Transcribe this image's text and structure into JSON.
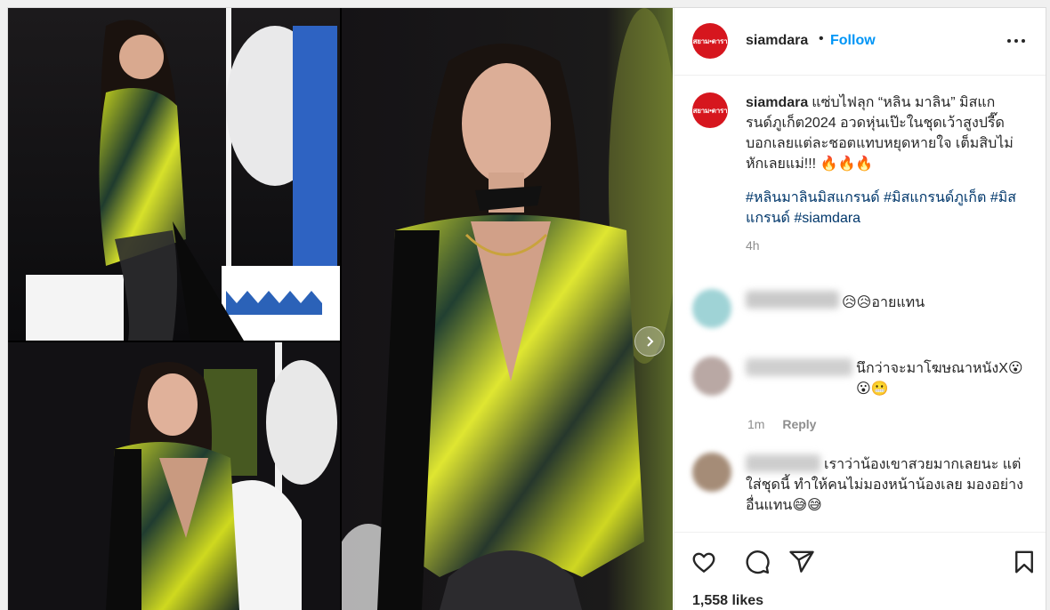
{
  "post": {
    "username": "siamdara",
    "follow_label": "Follow",
    "avatar_text": "สยาม•ดารา",
    "caption_text": "แซ่บไฟลุก “หลิน มาลิน” มิสแกรนด์ภูเก็ต2024 อวดหุ่นเป๊ะในชุดเว้าสูงปรี๊ดบอกเลยแต่ละชอตแทบหยุดหายใจ เต็มสิบไม่หักเลยแม่!!! 🔥🔥🔥",
    "hashtags": [
      "#หลินมาลินมิสแกรนด์",
      "#มิสแกรนด์ภูเก็ต",
      "#มิสแกรนด์",
      "#siamdara"
    ],
    "time_ago": "4h",
    "likes": "1,558 likes"
  },
  "comments": [
    {
      "text": "😥😥อายแทน",
      "avatar_color": "#9fd3d6",
      "meta_time": "",
      "meta_reply": ""
    },
    {
      "text": "นึกว่าจะมาโฆษณาหนังX😮😮😬",
      "avatar_color": "#b9a8a4",
      "meta_time": "1m",
      "meta_reply": "Reply"
    },
    {
      "text": "เราว่าน้องเขาสวยมากเลยนะ แต่ใส่ชุดนี้ ทำให้คนไม่มองหน้าน้องเลย มองอย่างอื่นแทน😅😅",
      "avatar_color": "#a58c77",
      "meta_time": "",
      "meta_reply": ""
    }
  ],
  "icons": {
    "more": "more-options-icon",
    "like": "heart-icon",
    "comment": "comment-bubble-icon",
    "share": "paper-plane-icon",
    "save": "bookmark-icon",
    "next": "chevron-right-icon"
  },
  "colors": {
    "brand_red": "#d6161e",
    "follow_blue": "#0095f6",
    "hashtag_blue": "#00376b",
    "muted_gray": "#8e8e8e"
  }
}
